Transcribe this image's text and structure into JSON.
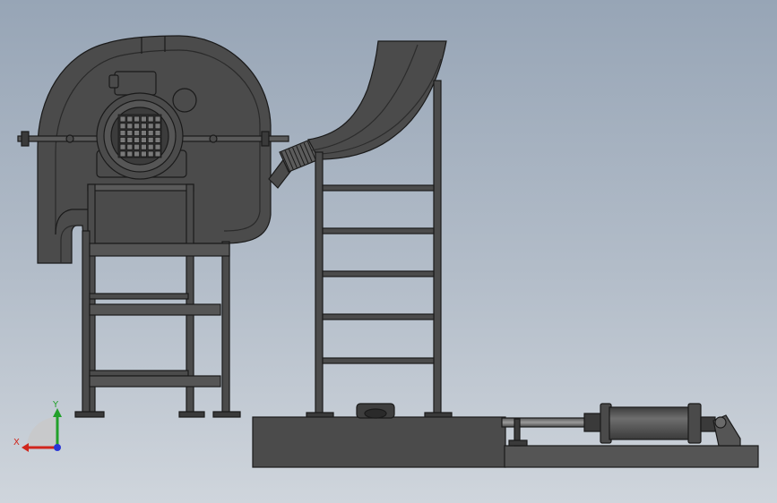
{
  "triad": {
    "y_label": "Y",
    "x_label": "X",
    "y_color": "#22a02a",
    "x_color": "#d0261c",
    "z_color": "#2a37d6"
  },
  "colors": {
    "steel": "#4b4b4b",
    "steel_light": "#6a6a6a",
    "edge": "#1a1a1a",
    "background_top": "#97a5b6",
    "background_bottom": "#cfd5dc"
  }
}
